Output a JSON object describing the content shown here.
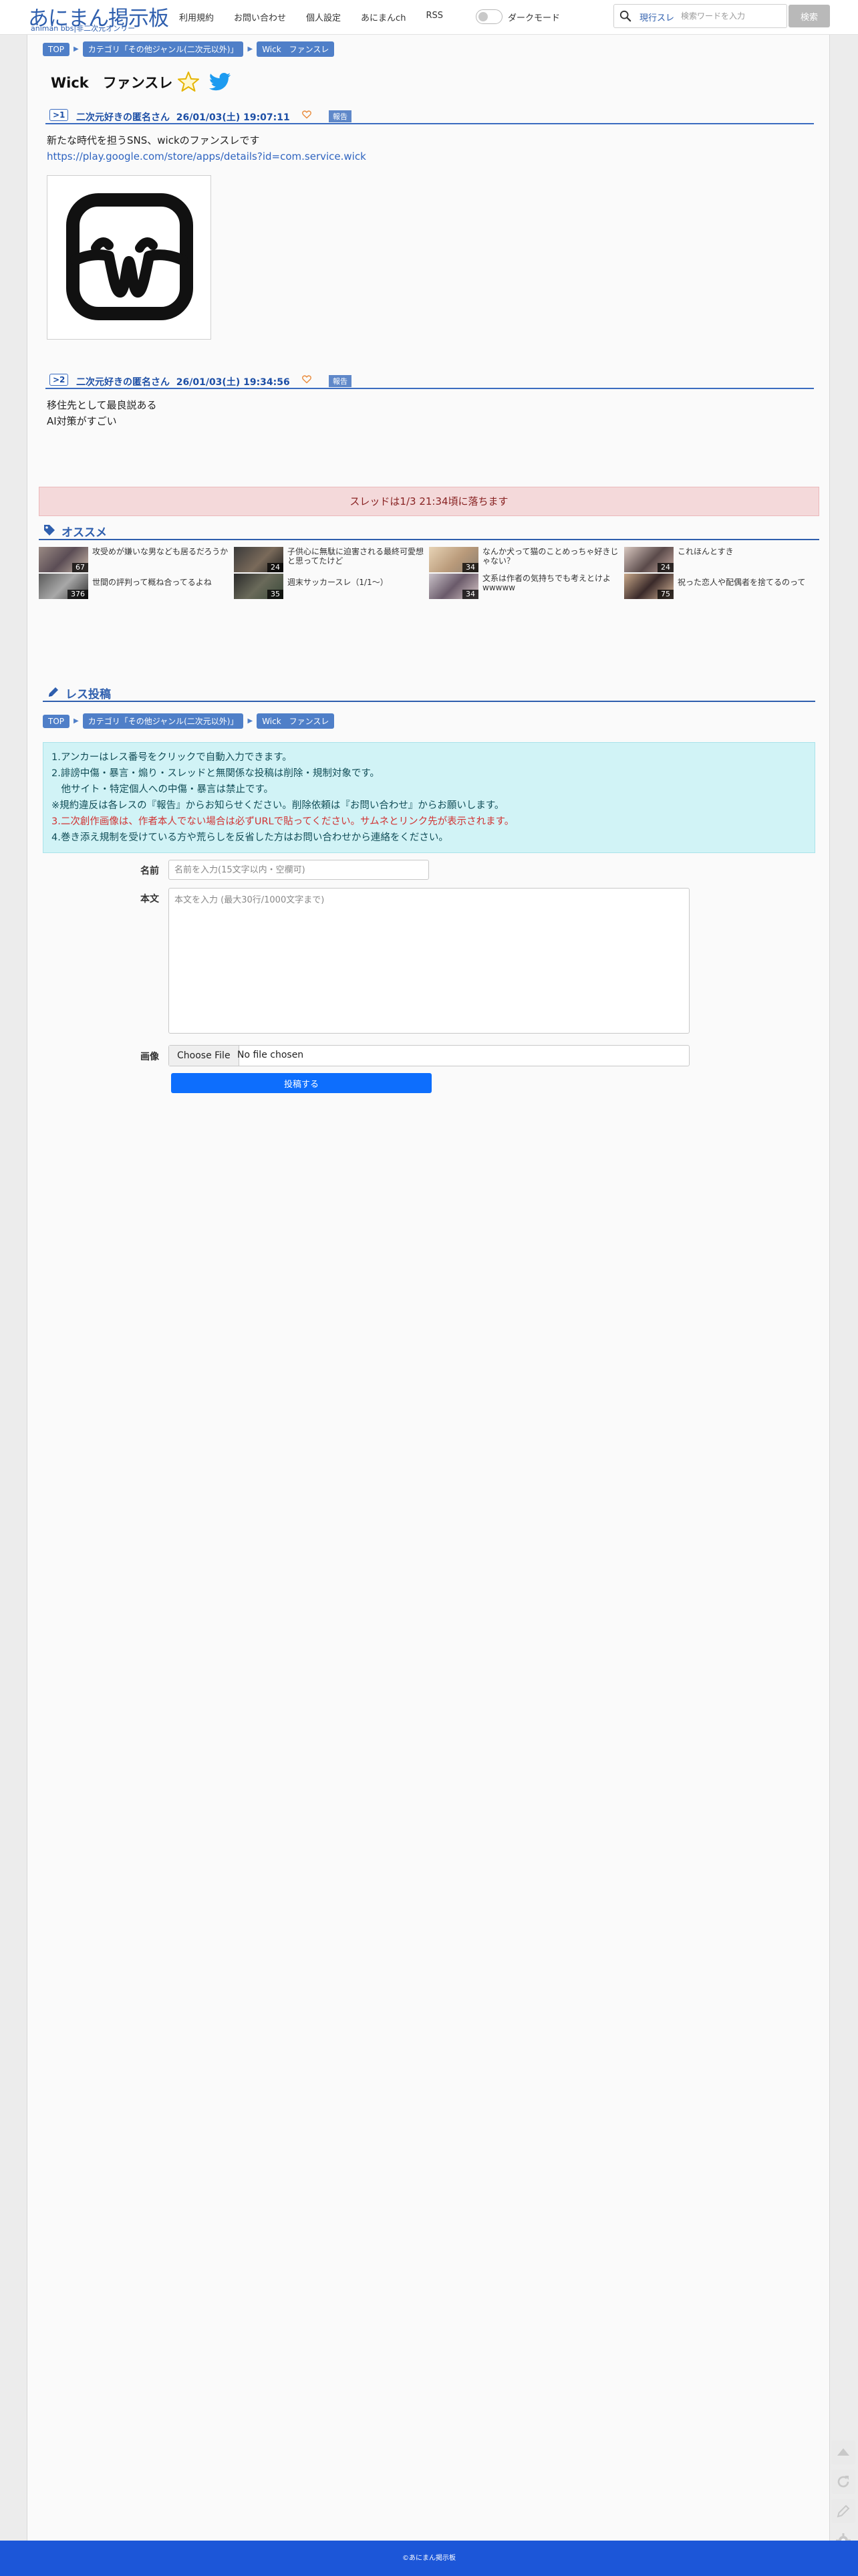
{
  "header": {
    "logo_main": "あにまん掲示板",
    "logo_sub": "animan bbs|非二次元オンリー",
    "nav": [
      "利用規約",
      "お問い合わせ",
      "個人設定",
      "あにまんch",
      "RSS"
    ],
    "dark_mode_label": "ダークモード",
    "search_scope": "現行スレ",
    "search_placeholder": "検索ワードを入力",
    "search_button": "検索"
  },
  "breadcrumb": {
    "top": "TOP",
    "category": "カテゴリ「その他ジャンル(二次元以外)」",
    "thread": "Wick　ファンスレ"
  },
  "thread": {
    "title": "Wick　ファンスレ"
  },
  "posts": [
    {
      "num": ">1",
      "name": "二次元好きの匿名さん",
      "date": "26/01/03(土) 19:07:11",
      "report": "報告",
      "lines": [
        "新たな時代を担うSNS、wickのファンスレです"
      ],
      "link": "https://play.google.com/store/apps/details?id=com.service.wick"
    },
    {
      "num": ">2",
      "name": "二次元好きの匿名さん",
      "date": "26/01/03(土) 19:34:56",
      "report": "報告",
      "lines": [
        "移住先として最良説ある",
        "AI対策がすごい"
      ]
    }
  ],
  "drop_notice": "スレッドは1/3 21:34頃に落ちます",
  "recommend": {
    "title": "オススメ",
    "items": [
      {
        "title": "攻受めが嫌いな男なども居るだろうか",
        "count": "67"
      },
      {
        "title": "子供心に無駄に迫害される最終可愛想と思ってたけど",
        "count": "24"
      },
      {
        "title": "なんか犬って猫のことめっちゃ好きじゃない？",
        "count": "34"
      },
      {
        "title": "これほんとすき",
        "count": "24"
      },
      {
        "title": "世間の評判って概ね合ってるよね",
        "count": "376"
      },
      {
        "title": "週末サッカースレ（1/1〜）",
        "count": "35"
      },
      {
        "title": "文系は作者の気持ちでも考えとけよwwwww",
        "count": "34"
      },
      {
        "title": "祝った恋人や配偶者を捨てるのって",
        "count": "75"
      }
    ]
  },
  "reply_form": {
    "title": "レス投稿",
    "rules": [
      "1.アンカーはレス番号をクリックで自動入力できます。",
      "2.誹謗中傷・暴言・煽り・スレッドと無関係な投稿は削除・規制対象です。",
      "　他サイト・特定個人への中傷・暴言は禁止です。",
      "※規約違反は各レスの『報告』からお知らせください。削除依頼は『お問い合わせ』からお願いします。",
      "3.二次創作画像は、作者本人でない場合は必ずURLで貼ってください。サムネとリンク先が表示されます。",
      "4.巻き添え規制を受けている方や荒らしを反省した方はお問い合わせから連絡をください。"
    ],
    "name_label": "名前",
    "name_placeholder": "名前を入力(15文字以内・空欄可)",
    "body_label": "本文",
    "body_placeholder": "本文を入力 (最大30行/1000文字まで)",
    "image_label": "画像",
    "file_button": "Choose File",
    "file_status": "No file chosen",
    "submit": "投稿する"
  },
  "footer": "©あにまん掲示板",
  "colors": {
    "accent": "#2f5fae",
    "footer": "#1c56d8",
    "submit": "#0d6efd",
    "notice_bg": "#f4d9da",
    "info_bg": "#d1f3f6"
  }
}
